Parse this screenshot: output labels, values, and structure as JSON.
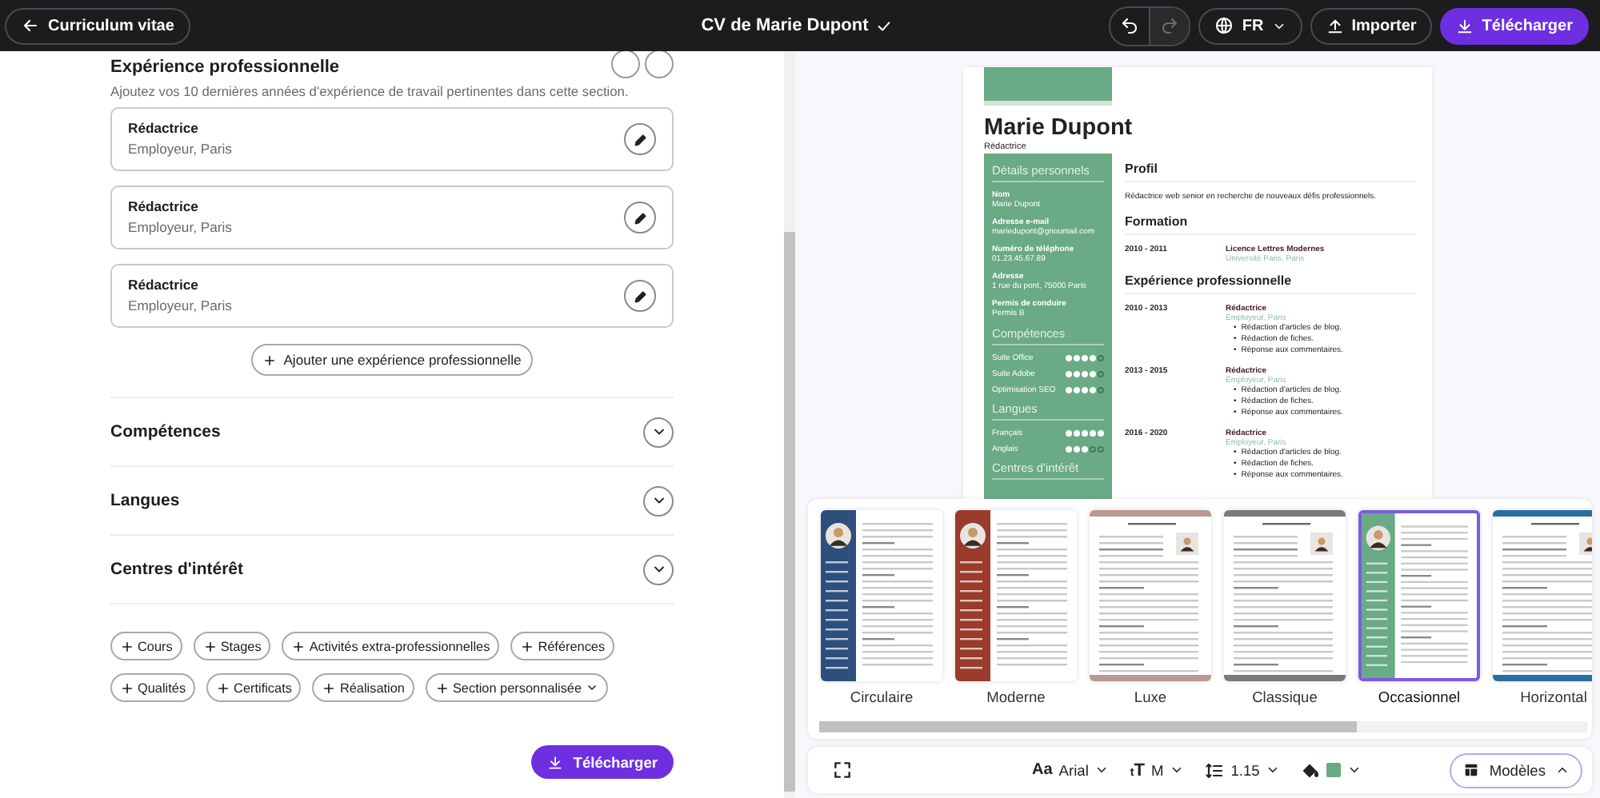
{
  "topbar": {
    "back_button": "Curriculum vitae",
    "document_title": "CV de Marie Dupont",
    "saved": true,
    "undo_disabled": false,
    "redo_disabled": true,
    "language": "FR",
    "import_button": "Importer",
    "download_button": "Télécharger"
  },
  "editor": {
    "section_title": "Expérience professionnelle",
    "description": "Ajoutez vos 10 dernières années d'expérience de travail pertinentes dans cette section.",
    "entries": [
      {
        "title": "Rédactrice",
        "subtitle": "Employeur, Paris"
      },
      {
        "title": "Rédactrice",
        "subtitle": "Employeur, Paris"
      },
      {
        "title": "Rédactrice",
        "subtitle": "Employeur, Paris"
      }
    ],
    "add_button": "Ajouter une expérience professionnelle",
    "sections": [
      {
        "title": "Compétences",
        "expanded": false
      },
      {
        "title": "Langues",
        "expanded": false
      },
      {
        "title": "Centres d'intérêt",
        "expanded": false
      }
    ],
    "add_section_chips": [
      {
        "label": "Cours",
        "dropdown": false
      },
      {
        "label": "Stages",
        "dropdown": false
      },
      {
        "label": "Activités extra-professionnelles",
        "dropdown": false
      },
      {
        "label": "Références",
        "dropdown": false
      },
      {
        "label": "Qualités",
        "dropdown": false
      },
      {
        "label": "Certificats",
        "dropdown": false
      },
      {
        "label": "Réalisation",
        "dropdown": false
      },
      {
        "label": "Section personnalisée",
        "dropdown": true
      }
    ],
    "download_button": "Télécharger"
  },
  "preview": {
    "name": "Marie Dupont",
    "headline": "Rédactrice",
    "bullet": "•",
    "sidebar": [
      {
        "title": "Détails personnels",
        "kind": "details",
        "items": [
          {
            "label": "Nom",
            "value": "Marie Dupont"
          },
          {
            "label": "Adresse e-mail",
            "value": "mariedupont@gnoumail.com"
          },
          {
            "label": "Numéro de téléphone",
            "value": "01.23.45.67.89"
          },
          {
            "label": "Adresse",
            "value": "1 rue du pont, 75000 Paris"
          },
          {
            "label": "Permis de conduire",
            "value": "Permis B"
          }
        ]
      },
      {
        "title": "Compétences",
        "kind": "ratings",
        "items": [
          {
            "label": "Suite Office",
            "stars": 4
          },
          {
            "label": "Suite Adobe",
            "stars": 4
          },
          {
            "label": "Optimisation SEO",
            "stars": 4
          }
        ]
      },
      {
        "title": "Langues",
        "kind": "ratings",
        "items": [
          {
            "label": "Français",
            "stars": 5
          },
          {
            "label": "Anglais",
            "stars": 3
          }
        ]
      },
      {
        "title": "Centres d'intérêt",
        "kind": "heading"
      }
    ],
    "main": [
      {
        "title": "Profil",
        "kind": "text",
        "text": "Rédactrice web senior en recherche de nouveaux défis professionnels."
      },
      {
        "title": "Formation",
        "kind": "entries",
        "entries": [
          {
            "dates": "2010 - 2011",
            "title": "Licence Lettres Modernes",
            "subtitle": "Université Paris, Paris"
          }
        ]
      },
      {
        "title": "Expérience professionnelle",
        "kind": "entries",
        "entries": [
          {
            "dates": "2010 - 2013",
            "title": "Rédactrice",
            "subtitle": "Employeur, Paris",
            "bullets": [
              "Rédaction d'articles de blog.",
              "Rédaction de fiches.",
              "Réponse aux commentaires."
            ]
          },
          {
            "dates": "2013 - 2015",
            "title": "Rédactrice",
            "subtitle": "Employeur, Paris",
            "bullets": [
              "Rédaction d'articles de blog.",
              "Rédaction de fiches.",
              "Réponse aux commentaires."
            ]
          },
          {
            "dates": "2016 - 2020",
            "title": "Rédactrice",
            "subtitle": "Employeur, Paris",
            "bullets": [
              "Rédaction d'articles de blog.",
              "Rédaction de fiches.",
              "Réponse aux commentaires."
            ]
          }
        ]
      }
    ]
  },
  "templates": [
    {
      "name": "Circulaire",
      "kind": "sidebar",
      "color": "#2d4f7c",
      "selected": false
    },
    {
      "name": "Moderne",
      "kind": "sidebar",
      "color": "#9a3b2b",
      "selected": false
    },
    {
      "name": "Luxe",
      "kind": "top",
      "color": "#b89a92",
      "selected": false
    },
    {
      "name": "Classique",
      "kind": "top",
      "color": "#7a7a7a",
      "selected": false
    },
    {
      "name": "Occasionnel",
      "kind": "sidebar",
      "color": "#6aaa85",
      "selected": true
    },
    {
      "name": "Horizontal",
      "kind": "top",
      "color": "#2a6ea0",
      "selected": false
    }
  ],
  "toolbar": {
    "font_icon": "Aa",
    "font": "Arial",
    "size_icon": "tT",
    "text_size": "M",
    "line_spacing": "1.15",
    "swatch": {
      "color": "#6aaa85"
    },
    "templates_button": "Modèles",
    "templates_open": true
  }
}
